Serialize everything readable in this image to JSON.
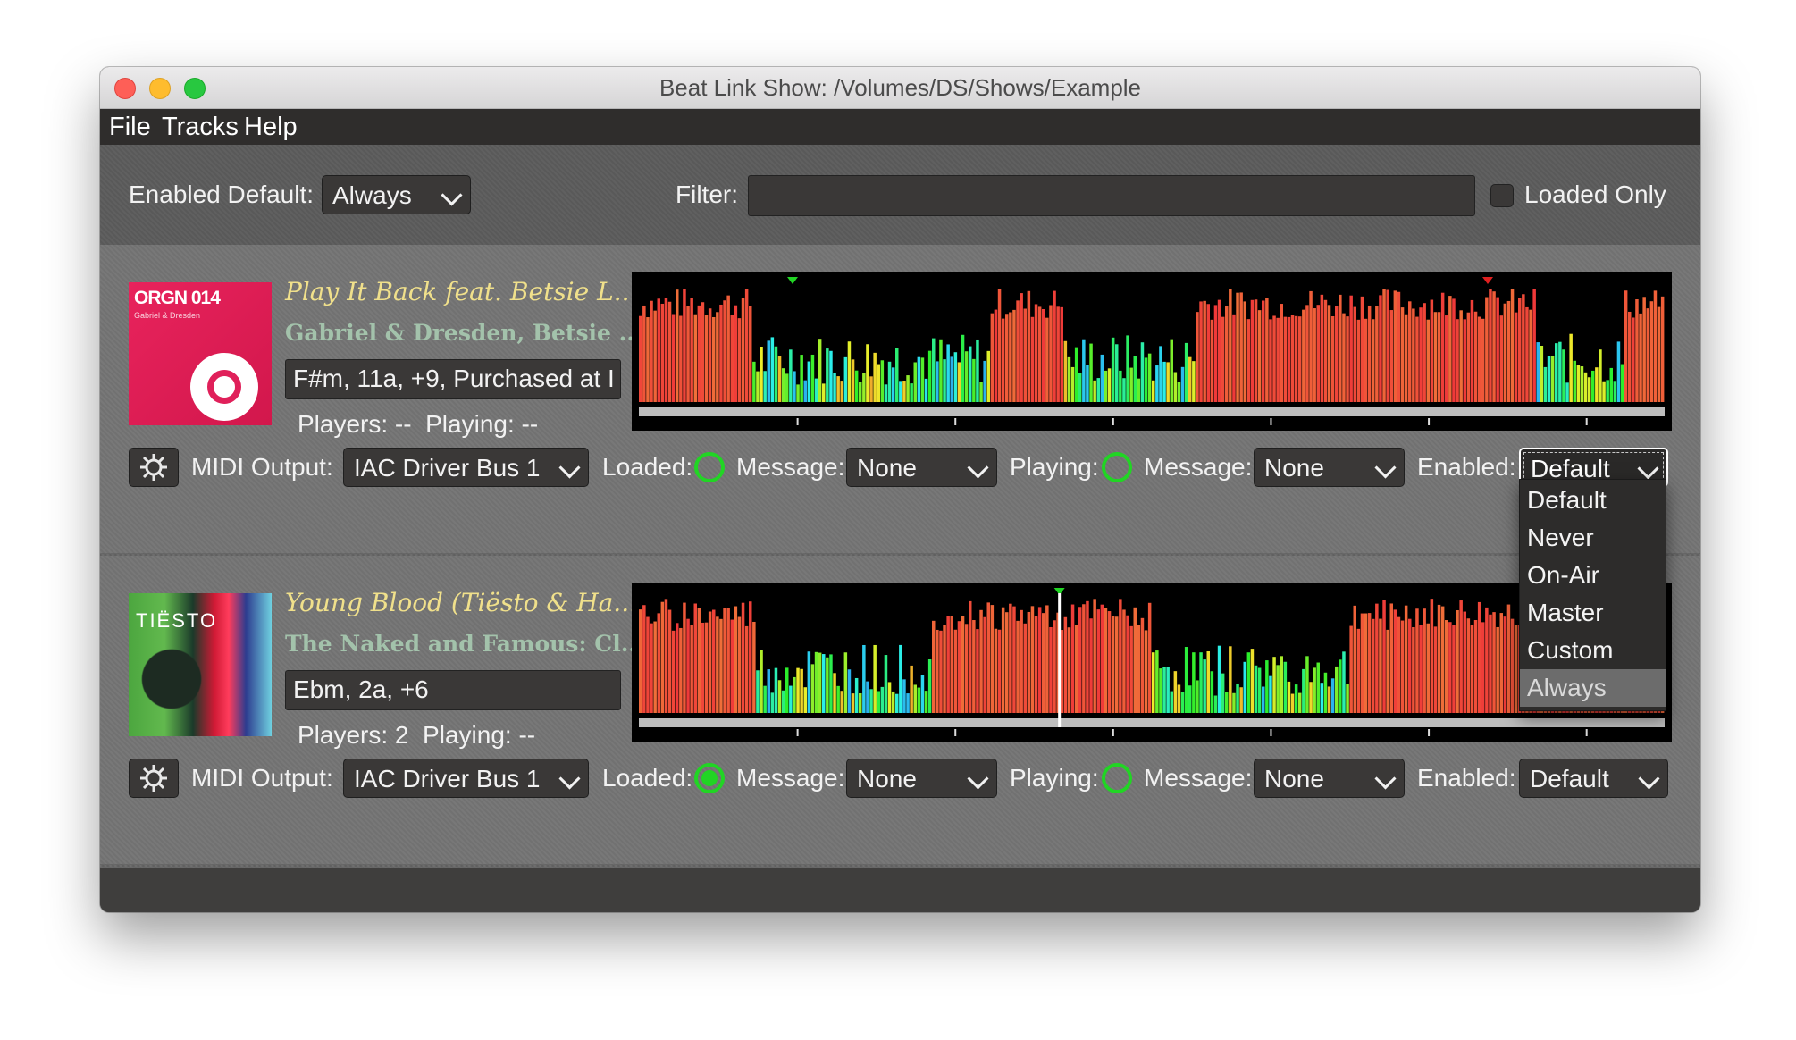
{
  "window": {
    "title": "Beat Link Show: /Volumes/DS/Shows/Example"
  },
  "menu": [
    "File",
    "Tracks",
    "Help"
  ],
  "filterbar": {
    "enabled_default_label": "Enabled Default:",
    "enabled_default_value": "Always",
    "filter_label": "Filter:",
    "filter_value": "",
    "loaded_only_label": "Loaded Only",
    "loaded_only_checked": false
  },
  "tracks": [
    {
      "art_text": "ORGN 014",
      "art_subtext": "Gabriel & Dresden",
      "title": "Play It Back feat. Betsie L...",
      "artist": "Gabriel & Dresden, Betsie ...",
      "comment": "F#m, 11a, +9, Purchased at I",
      "players_status": "Players: --  Playing: --",
      "midi_output_label": "MIDI Output:",
      "midi_output": "IAC Driver Bus 1",
      "loaded_label": "Loaded:",
      "loaded_active": false,
      "loaded_message_label": "Message:",
      "loaded_message": "None",
      "playing_label": "Playing:",
      "playing_active": false,
      "playing_message_label": "Message:",
      "playing_message": "None",
      "enabled_label": "Enabled:",
      "enabled": "Default",
      "enabled_focused": true,
      "waveform_seed": 7,
      "playhead_fraction": null
    },
    {
      "art_text": "TIËSTO",
      "art_subtext": "",
      "title": "Young Blood (Tiësto & Ha...",
      "artist": "The Naked and Famous: Cl...",
      "comment": "Ebm, 2a, +6",
      "players_status": "Players: 2  Playing: --",
      "midi_output_label": "MIDI Output:",
      "midi_output": "IAC Driver Bus 1",
      "loaded_label": "Loaded:",
      "loaded_active": true,
      "loaded_message_label": "Message:",
      "loaded_message": "None",
      "playing_label": "Playing:",
      "playing_active": false,
      "playing_message_label": "Message:",
      "playing_message": "None",
      "enabled_label": "Enabled:",
      "enabled": "Default",
      "enabled_focused": false,
      "waveform_seed": 19,
      "playhead_fraction": 0.41
    }
  ],
  "enabled_dropdown": {
    "open": true,
    "options": [
      "Default",
      "Never",
      "On-Air",
      "Master",
      "Custom",
      "Always"
    ],
    "highlighted": "Always"
  },
  "colors": {
    "accent_green": "#21d524",
    "title_yellow": "#f0e08b",
    "artist_green": "#a3c2ab"
  }
}
